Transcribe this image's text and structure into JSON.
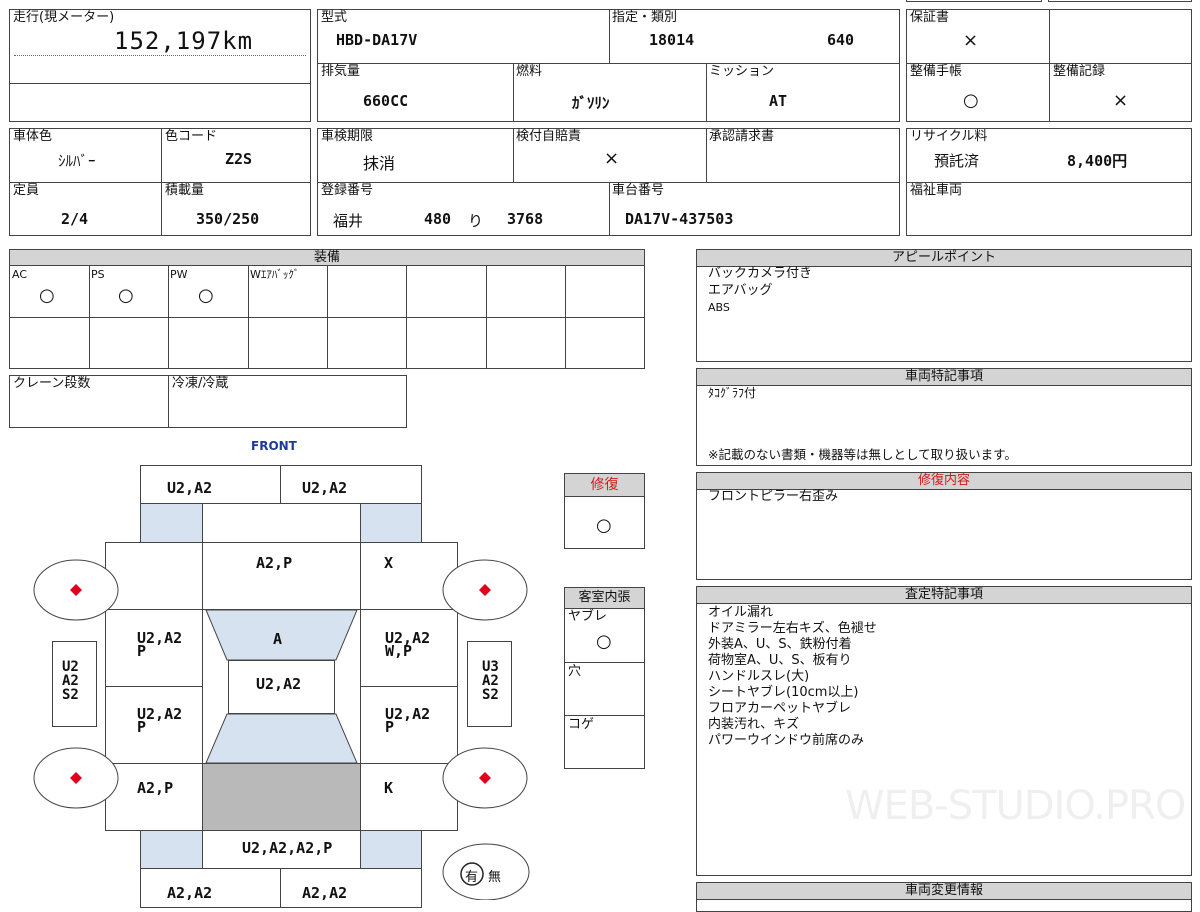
{
  "top": {
    "mileage_label": "走行(現メーター)",
    "mileage_value": "152,197km",
    "model_label": "型式",
    "model_value": "HBD-DA17V",
    "designation_label": "指定・類別",
    "designation_value": "18014",
    "category_value": "640",
    "warranty_label": "保証書",
    "warranty_value": "×",
    "displacement_label": "排気量",
    "displacement_value": "660CC",
    "fuel_label": "燃料",
    "fuel_value": "ｶﾞｿﾘﾝ",
    "transmission_label": "ミッション",
    "transmission_value": "AT",
    "maintenance_book_label": "整備手帳",
    "maintenance_book_value": "○",
    "maintenance_record_label": "整備記録",
    "maintenance_record_value": "×",
    "color_label": "車体色",
    "color_value": "ｼﾙﾊﾞｰ",
    "color_code_label": "色コード",
    "color_code_value": "Z2S",
    "inspection_label": "車検期限",
    "inspection_value": "抹消",
    "insurance_label": "検付自賠責",
    "insurance_value": "×",
    "approval_label": "承認請求書",
    "recycle_label": "リサイクル料",
    "recycle_status": "預託済",
    "recycle_amount": "8,400円",
    "capacity_label": "定員",
    "capacity_value": "2/4",
    "load_label": "積載量",
    "load_value": "350/250",
    "registration_label": "登録番号",
    "registration_area": "福井",
    "registration_class": "480",
    "registration_kana": "り",
    "registration_number": "3768",
    "chassis_label": "車台番号",
    "chassis_value": "DA17V-437503",
    "welfare_label": "福祉車両"
  },
  "equipment": {
    "title": "装備",
    "items": [
      {
        "label": "AC",
        "value": "○"
      },
      {
        "label": "PS",
        "value": "○"
      },
      {
        "label": "PW",
        "value": "○"
      },
      {
        "label": "Wｴｱﾊﾞｯｸﾞ",
        "value": ""
      }
    ],
    "crane_label": "クレーン段数",
    "freezer_label": "冷凍/冷蔵"
  },
  "diagram": {
    "front_label": "FRONT",
    "top_left": "U2,A2",
    "top_right": "U2,A2",
    "hood": "A2,P",
    "front_right_fender": "X",
    "windshield": "A",
    "roof": "U2,A2",
    "left_front_door_l1": "U2,A2",
    "left_front_door_l2": "P",
    "right_front_door_l1": "U2,A2",
    "right_front_door_l2": "W,P",
    "left_rear_door_l1": "U2,A2",
    "left_rear_door_l2": "P",
    "right_rear_door_l1": "U2,A2",
    "right_rear_door_l2": "P",
    "left_rear_fender": "A2,P",
    "right_rear_fender": "K",
    "rear": "U2,A2,A2,P",
    "bottom_left": "A2,A2",
    "bottom_right": "A2,A2",
    "left_sill_l1": "U2",
    "left_sill_l2": "A2",
    "left_sill_l3": "S2",
    "right_sill_l1": "U3",
    "right_sill_l2": "A2",
    "right_sill_l3": "S2",
    "presence_yes": "有",
    "presence_no": "無"
  },
  "repair": {
    "title": "修復",
    "value": "○"
  },
  "interior": {
    "title": "客室内張",
    "tear_label": "ヤブレ",
    "tear_value": "○",
    "hole_label": "穴",
    "burn_label": "コゲ"
  },
  "appeal": {
    "title": "アピールポイント",
    "lines": [
      "バックカメラ付き",
      "エアバッグ",
      "ABS"
    ]
  },
  "special_notes": {
    "title": "車両特記事項",
    "line1": "ﾀｺｸﾞﾗﾌ付",
    "footer": "※記載のない書類・機器等は無しとして取り扱います。"
  },
  "repair_details": {
    "title": "修復内容",
    "line1": "フロントピラー右歪み"
  },
  "assessment": {
    "title": "査定特記事項",
    "lines": [
      "オイル漏れ",
      "ドアミラー左右キズ、色褪せ",
      "外装A、U、S、鉄粉付着",
      "荷物室A、U、S、板有り",
      "ハンドルスレ(大)",
      "シートヤブレ(10cm以上)",
      "フロアカーペットヤブレ",
      "内装汚れ、キズ",
      "パワーウインドウ前席のみ"
    ]
  },
  "changes": {
    "title": "車両変更情報"
  },
  "watermark": "WEB-STUDIO.PRO",
  "colors": {
    "header_gray": "#d4d4d4",
    "glass_blue": "#d6e2ef",
    "dot_red": "#e0001b",
    "front_blue": "#1f3a9a",
    "repair_red": "#d21b1b"
  }
}
